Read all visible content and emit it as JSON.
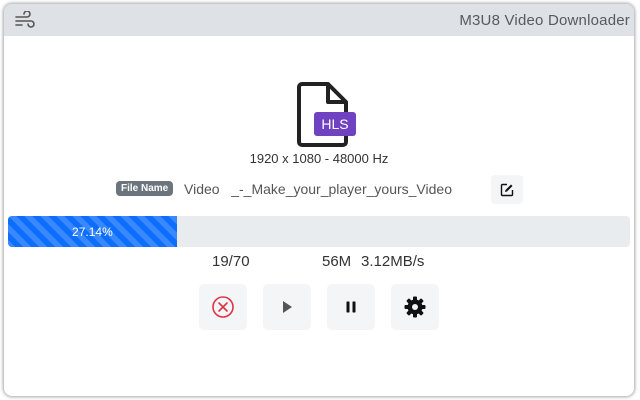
{
  "header": {
    "app_title": "M3U8 Video Downloader",
    "menu_icon": "wind-lines-icon"
  },
  "media": {
    "format_badge": "HLS",
    "info": "1920 x 1080 - 48000 Hz",
    "file_label": "File Name",
    "file_name": "Video   _-_Make_your_player_yours_Video"
  },
  "progress": {
    "percent_label": "27.14%",
    "percent": 27.14,
    "segments": "19/70",
    "size": "56M",
    "speed": "3.12MB/s"
  },
  "controls": {
    "cancel_icon": "cancel-circle-icon",
    "play_icon": "play-icon",
    "pause_icon": "pause-icon",
    "settings_icon": "gear-icon"
  },
  "colors": {
    "accent": "#0d6efd",
    "badge": "#6f42c1",
    "cancel": "#dc3545",
    "header_bg": "#dee2e6"
  }
}
